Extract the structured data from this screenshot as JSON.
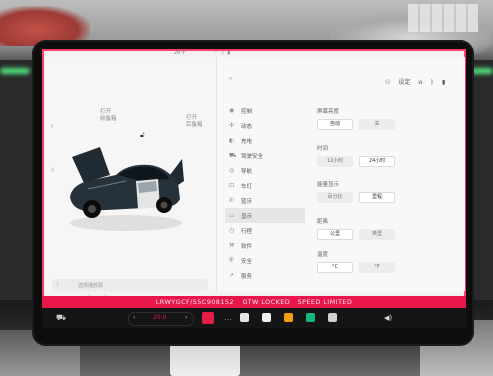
{
  "statusbar": {
    "temperature": "26°F",
    "icons": [
      "wifi-icon",
      "bluetooth-icon",
      "signal-icon"
    ]
  },
  "car_panel": {
    "front_trunk": {
      "action": "打开",
      "label": "前备箱"
    },
    "rear_trunk": {
      "action": "打开",
      "label": "后备箱"
    },
    "media_text": "选择播放源"
  },
  "settings": {
    "search_placeholder": "",
    "profile_label": "设定",
    "menu": [
      {
        "icon": "wheel-icon",
        "label": "控制"
      },
      {
        "icon": "fan-icon",
        "label": "动态"
      },
      {
        "icon": "bulb-icon",
        "label": "充电"
      },
      {
        "icon": "car-icon",
        "label": "驾驶安全"
      },
      {
        "icon": "steering-icon",
        "label": "导航"
      },
      {
        "icon": "lock-icon",
        "label": "车灯"
      },
      {
        "icon": "phone-icon",
        "label": "蓝牙"
      },
      {
        "icon": "display-icon",
        "label": "显示",
        "active": true
      },
      {
        "icon": "clock-icon",
        "label": "行程"
      },
      {
        "icon": "wrench-icon",
        "label": "软件"
      },
      {
        "icon": "shield-icon",
        "label": "安全"
      },
      {
        "icon": "arrow-icon",
        "label": "服务"
      }
    ],
    "sections": [
      {
        "label": "屏幕亮度",
        "options": [
          {
            "text": "自动",
            "selected": true
          },
          {
            "text": "关",
            "selected": false
          }
        ]
      },
      {
        "label": "时间",
        "options": [
          {
            "text": "12小时",
            "selected": false
          },
          {
            "text": "24小时",
            "selected": true
          }
        ]
      },
      {
        "label": "能量显示",
        "options": [
          {
            "text": "百分比",
            "selected": false
          },
          {
            "text": "里程",
            "selected": true
          }
        ]
      },
      {
        "label": "距离",
        "options": [
          {
            "text": "公里",
            "selected": true
          },
          {
            "text": "英里",
            "selected": false
          }
        ]
      },
      {
        "label": "温度",
        "options": [
          {
            "text": "°C",
            "selected": true
          },
          {
            "text": "°F",
            "selected": false
          }
        ]
      }
    ]
  },
  "info_strip": {
    "vin": "LRWYGCF/S5C908152",
    "gtw": "GTW LOCKED",
    "speed": "SPEED LIMITED"
  },
  "dock": {
    "temperature": "20.0",
    "colors": {
      "accent": "#e8164b",
      "app_blue": "#3b82f6",
      "app_orange": "#f59e0b",
      "app_green": "#10b981"
    }
  }
}
